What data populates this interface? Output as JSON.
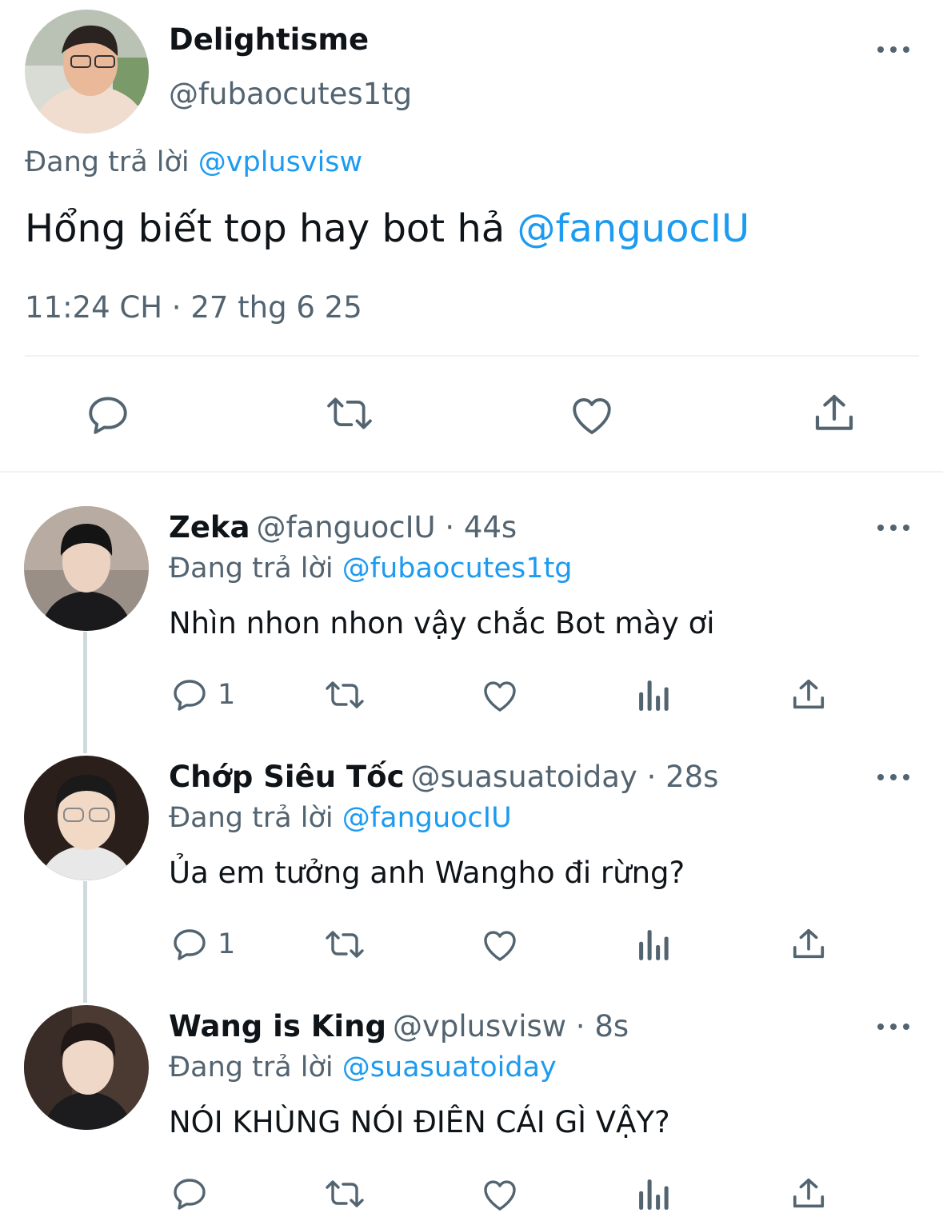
{
  "main_tweet": {
    "name": "Delightisme",
    "handle": "@fubaocutes1tg",
    "replying_prefix": "Đang trả lời",
    "replying_to": "@vplusvisw",
    "text_prefix": "Hổng biết top hay bot hả",
    "mention": "@fanguocIU",
    "timestamp": "11:24 CH · 27 thg 6 25"
  },
  "replies": [
    {
      "name": "Zeka",
      "handle": "@fanguocIU · 44s",
      "replying_prefix": "Đang trả lời",
      "replying_to": "@fubaocutes1tg",
      "text": "Nhìn nhon nhon vậy chắc Bot mày ơi",
      "reply_count": "1"
    },
    {
      "name": "Chớp Siêu Tốc",
      "handle": "@suasuatoiday · 28s",
      "replying_prefix": "Đang trả lời",
      "replying_to": "@fanguocIU",
      "text": "Ủa em tưởng anh Wangho đi rừng?",
      "reply_count": "1"
    },
    {
      "name": "Wang is King",
      "handle": "@vplusvisw · 8s",
      "replying_prefix": "Đang trả lời",
      "replying_to": "@suasuatoiday",
      "text": "NÓI KHÙNG NÓI ĐIÊN CÁI GÌ VẬY?",
      "reply_count": ""
    }
  ],
  "icons": [
    "reply-icon",
    "retweet-icon",
    "like-icon",
    "share-icon",
    "views-icon",
    "more-icon"
  ],
  "colors": {
    "accent": "#1d9bf0",
    "secondary_text": "#536471",
    "primary_text": "#0f1419",
    "divider": "#eff3f4"
  }
}
